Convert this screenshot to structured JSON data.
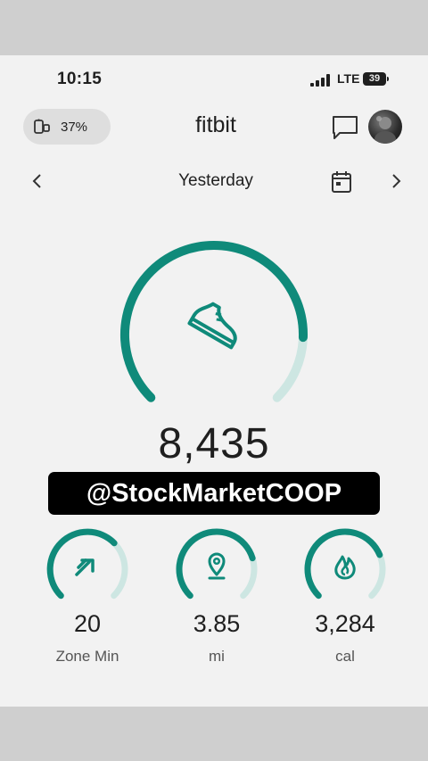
{
  "status_bar": {
    "time": "10:15",
    "network": "LTE",
    "battery": "39"
  },
  "header": {
    "device_battery": "37%",
    "title": "fitbit"
  },
  "date_nav": {
    "label": "Yesterday"
  },
  "steps": {
    "value": "8,435",
    "goal_progress": 0.84,
    "icon": "shoe-icon"
  },
  "watermark": "@StockMarketCOOP",
  "stats": [
    {
      "value": "20",
      "label": "Zone Min",
      "icon": "zone-arrow-icon",
      "progress": 0.67
    },
    {
      "value": "3.85",
      "label": "mi",
      "icon": "location-pin-icon",
      "progress": 0.77
    },
    {
      "value": "3,284",
      "label": "cal",
      "icon": "flame-icon",
      "progress": 0.75
    }
  ],
  "colors": {
    "accent": "#0f8a7a",
    "track": "#cde6e2",
    "background": "#f2f2f2"
  }
}
